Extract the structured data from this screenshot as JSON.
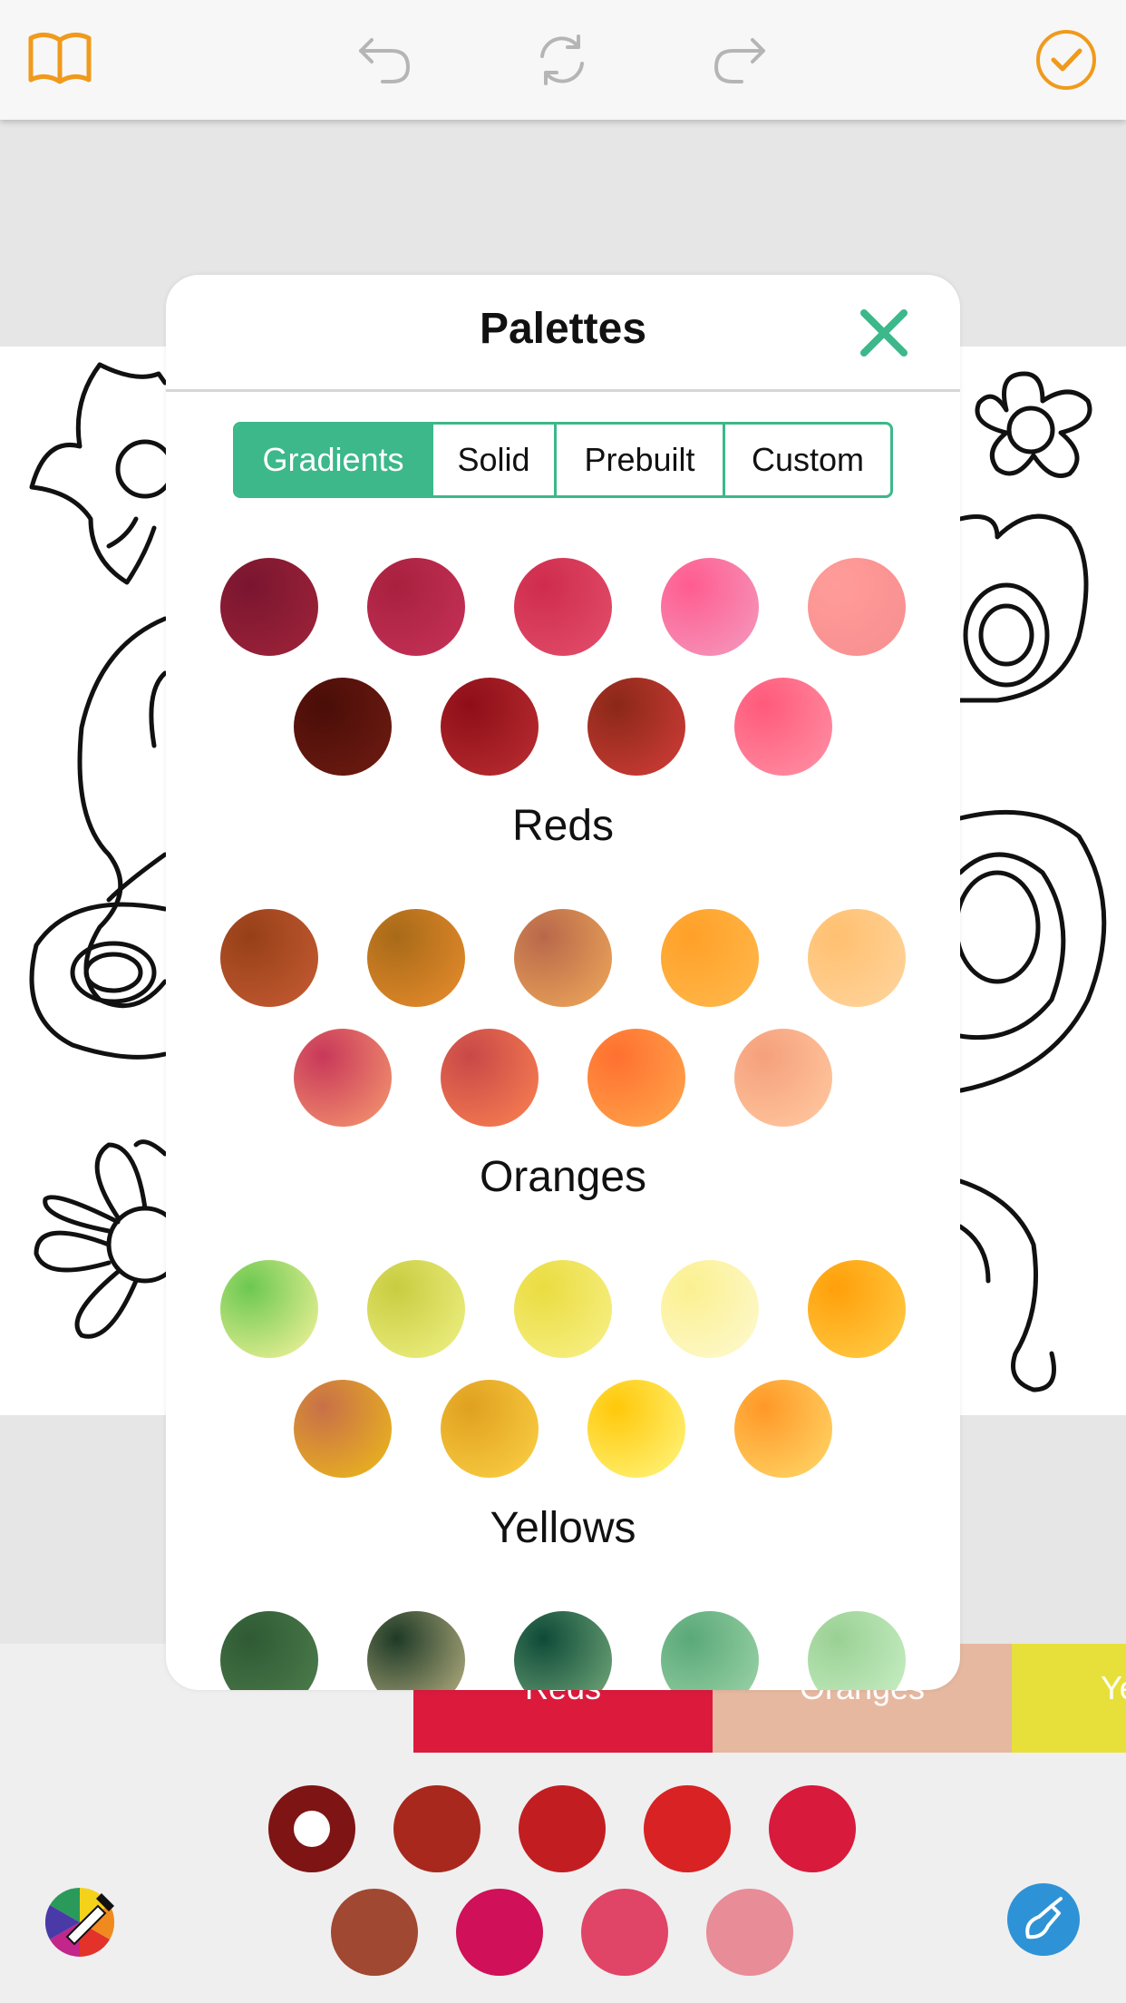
{
  "toolbar": {
    "icons": [
      "book-icon",
      "undo-icon",
      "refresh-icon",
      "redo-icon",
      "done-check-icon"
    ],
    "accent": "#f09a1c",
    "disabled": "#b5b5b5"
  },
  "modal": {
    "title": "Palettes",
    "close_icon": "close-icon",
    "accent": "#3cb88a",
    "tabs": [
      {
        "label": "Gradients",
        "active": true
      },
      {
        "label": "Solid",
        "active": false
      },
      {
        "label": "Prebuilt",
        "active": false
      },
      {
        "label": "Custom",
        "active": false
      }
    ],
    "palettes": [
      {
        "name": "Reds",
        "swatches": [
          [
            "#7a1530",
            "#9a2238"
          ],
          [
            "#a8203e",
            "#c23055"
          ],
          [
            "#cf2c4c",
            "#e04a68"
          ],
          [
            "#ff5c90",
            "#f592b8"
          ],
          [
            "#ff9c98",
            "#f89092"
          ],
          [
            "#4a0d08",
            "#6a1a10"
          ],
          [
            "#8e0e18",
            "#b42a2e"
          ],
          [
            "#8a2818",
            "#c83a34"
          ],
          [
            "#ff5a7a",
            "#ff8aa0"
          ]
        ]
      },
      {
        "name": "Oranges",
        "swatches": [
          [
            "#964018",
            "#c05830"
          ],
          [
            "#a86a18",
            "#e0882a"
          ],
          [
            "#b8684a",
            "#e8a058"
          ],
          [
            "#ffa028",
            "#ffb648"
          ],
          [
            "#ffc070",
            "#ffd298"
          ],
          [
            "#c8385a",
            "#f08c6c"
          ],
          [
            "#c84848",
            "#f47a50"
          ],
          [
            "#ff7030",
            "#ffa048"
          ],
          [
            "#f4a07c",
            "#ffc49c"
          ]
        ]
      },
      {
        "name": "Yellows",
        "swatches": [
          [
            "#6cc850",
            "#e4ee92"
          ],
          [
            "#c8cc40",
            "#eaec7c"
          ],
          [
            "#eadc40",
            "#f6ee80"
          ],
          [
            "#fbf090",
            "#fdf8c8"
          ],
          [
            "#ff9f0a",
            "#ffc840"
          ],
          [
            "#c87048",
            "#e8b020"
          ],
          [
            "#e0a020",
            "#f8ca40"
          ],
          [
            "#ffc80a",
            "#fff070"
          ],
          [
            "#ff9828",
            "#ffd060"
          ]
        ]
      },
      {
        "name": "",
        "swatches": [
          [
            "#2f5a34",
            "#4a7a4a"
          ],
          [
            "#1e3a26",
            "#a8a478"
          ],
          [
            "#0e4a38",
            "#6aa074"
          ],
          [
            "#5aa878",
            "#96d0a4"
          ],
          [
            "#9ad094",
            "#c4ecc0"
          ]
        ]
      }
    ]
  },
  "palette_tabs": [
    {
      "label": "Reds",
      "color": "#db1a3c"
    },
    {
      "label": "Oranges",
      "color": "#e6b8a0"
    },
    {
      "label": "Ye",
      "color": "#e8e03a"
    }
  ],
  "current_swatches": {
    "selected_index": 0,
    "row1": [
      "#7e1414",
      "#a8281e",
      "#c21e22",
      "#d82224",
      "#d81a3c"
    ],
    "row2": [
      "#a04832",
      "#d01058",
      "#e04466",
      "#e88c98"
    ]
  },
  "bottom_icons": [
    "color-wheel-picker-icon",
    "brush-icon"
  ]
}
